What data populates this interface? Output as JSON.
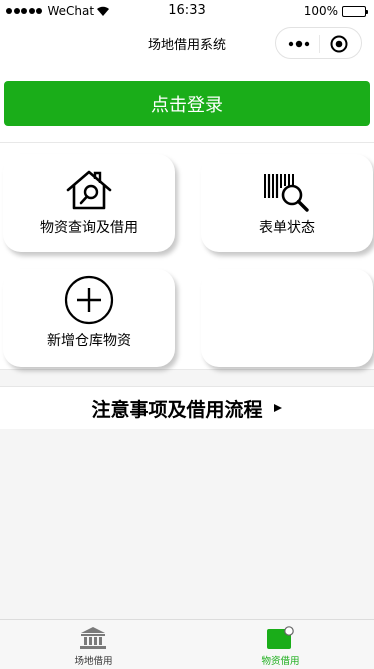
{
  "status_bar": {
    "carrier": "WeChat",
    "time": "16:33",
    "battery": "100%"
  },
  "nav": {
    "title": "场地借用系统",
    "more_icon": "more-dots-icon",
    "close_icon": "target-close-icon"
  },
  "login": {
    "label": "点击登录"
  },
  "grid": [
    {
      "label": "物资查询及借用",
      "icon": "house-search-icon"
    },
    {
      "label": "表单状态",
      "icon": "barcode-search-icon"
    },
    {
      "label": "新增仓库物资",
      "icon": "plus-circle-icon"
    },
    {
      "label": ""
    }
  ],
  "notice": {
    "label": "注意事项及借用流程"
  },
  "tabbar": {
    "items": [
      {
        "label": "场地借用",
        "icon": "bank-icon",
        "active": false
      },
      {
        "label": "物资借用",
        "icon": "green-square-badge-icon",
        "active": true
      }
    ]
  },
  "colors": {
    "primary_green": "#1aad19",
    "background": "#f5f5f5"
  }
}
